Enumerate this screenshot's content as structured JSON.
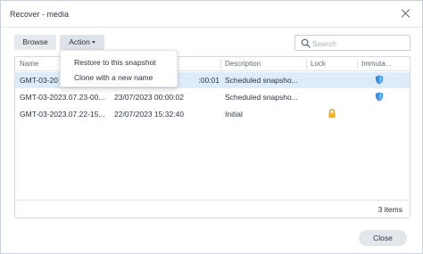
{
  "window": {
    "title": "Recover - media"
  },
  "toolbar": {
    "browse_label": "Browse",
    "action_label": "Action",
    "search_placeholder": "Search"
  },
  "action_menu": {
    "items": [
      {
        "label": "Restore to this snapshot"
      },
      {
        "label": "Clone with a new name"
      }
    ]
  },
  "table": {
    "columns": [
      "Name",
      "",
      "Description",
      "Lock",
      "Immuta..."
    ],
    "rows": [
      {
        "name": "GMT-03-20",
        "time": ":00:01",
        "description": "Scheduled snapsho...",
        "locked": false,
        "immutable": true,
        "selected": true
      },
      {
        "name": "GMT-03-2023.07.23-00...",
        "time": "23/07/2023 00:00:02",
        "description": "Scheduled snapsho...",
        "locked": false,
        "immutable": true,
        "selected": false
      },
      {
        "name": "GMT-03-2023.07.22-15...",
        "time": "22/07/2023 15:32:40",
        "description": "Initial",
        "locked": true,
        "immutable": false,
        "selected": false
      }
    ],
    "count_label": "3 items"
  },
  "footer": {
    "close_label": "Close"
  },
  "colors": {
    "selected_row": "#deecfa",
    "shield": "#3d8fe0",
    "lock": "#f0b429"
  }
}
